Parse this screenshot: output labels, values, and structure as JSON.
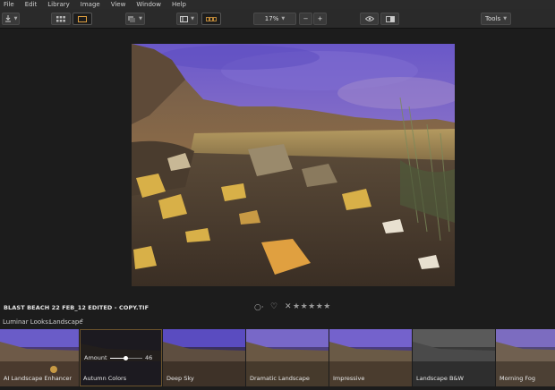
{
  "menu": [
    "File",
    "Edit",
    "Library",
    "Image",
    "View",
    "Window",
    "Help"
  ],
  "toolbar": {
    "zoom": "17%",
    "zoom_out": "−",
    "zoom_in": "+",
    "tools": "Tools"
  },
  "image": {
    "filename": "BLAST BEACH 22 FEB_12 EDITED - COPY.TIF",
    "rating_stars": 5,
    "stars_text": "★★★★★"
  },
  "looks": {
    "label": "Luminar Looks:",
    "category": "Landscape",
    "items": [
      {
        "label": "AI Landscape Enhancer",
        "style": "landscape"
      },
      {
        "label": "Autumn Colors",
        "style": "dark",
        "selected": true,
        "amount_label": "Amount",
        "amount": 46
      },
      {
        "label": "Deep Sky",
        "style": "landscape"
      },
      {
        "label": "Dramatic Landscape",
        "style": "landscape"
      },
      {
        "label": "Impressive",
        "style": "landscape"
      },
      {
        "label": "Landscape B&W",
        "style": "bw"
      },
      {
        "label": "Morning Fog",
        "style": "landscape"
      }
    ]
  },
  "colors": {
    "accent": "#d8a24a",
    "background": "#1c1c1c",
    "toolbar": "#2a2a2a"
  }
}
